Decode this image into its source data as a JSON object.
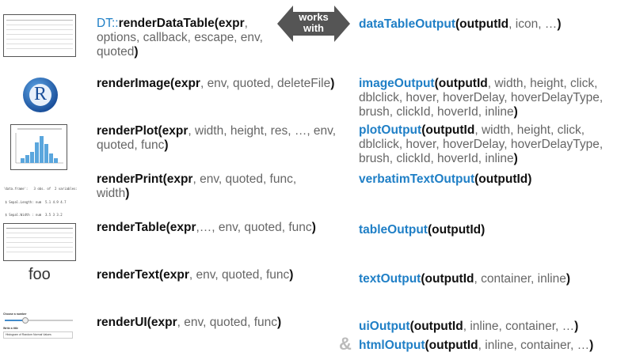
{
  "rows": [
    {
      "render_prefix": "DT::",
      "render_name": "renderDataTable",
      "render_args_open": "(expr",
      "render_args_rest": ", options, callback, escape, env, quoted",
      "render_close": ")",
      "output_name": "dataTableOutput",
      "output_open": "(outputId",
      "output_rest": ", icon, …",
      "output_close": ")"
    },
    {
      "render_name": "renderImage",
      "render_args_open": "(expr",
      "render_args_rest": ", env, quoted, deleteFile",
      "render_close": ")",
      "output_name": "imageOutput",
      "output_open": "(outputId",
      "output_rest": ", width, height, click, dblclick, hover, hoverDelay, hoverDelayType, brush, clickId, hoverId, inline",
      "output_close": ")"
    },
    {
      "render_name": "renderPlot",
      "render_args_open": "(expr",
      "render_args_rest": ", width, height, res, …, env, quoted, func",
      "render_close": ")",
      "output_name": "plotOutput",
      "output_open": "(outputId",
      "output_rest": ", width, height, click, dblclick, hover, hoverDelay, hoverDelayType, brush, clickId, hoverId, inline",
      "output_close": ")"
    },
    {
      "render_name": "renderPrint",
      "render_args_open": "(expr",
      "render_args_rest": ", env, quoted, func, width",
      "render_close": ")",
      "output_name": "verbatimTextOutput",
      "output_open": "(outputId",
      "output_rest": "",
      "output_close": ")"
    },
    {
      "render_name": "renderTable",
      "render_args_open": "(expr",
      "render_args_rest": ",…, env, quoted, func",
      "render_close": ")",
      "output_name": "tableOutput",
      "output_open": "(outputId",
      "output_rest": "",
      "output_close": ")"
    },
    {
      "render_name": "renderText",
      "render_args_open": "(expr",
      "render_args_rest": ", env, quoted, func",
      "render_close": ")",
      "output_name": "textOutput",
      "output_open": "(outputId",
      "output_rest": ", container, inline",
      "output_close": ")"
    },
    {
      "render_name": "renderUI",
      "render_args_open": "(expr",
      "render_args_rest": ", env, quoted, func",
      "render_close": ")",
      "output_name": "uiOutput",
      "output_open": "(outputId",
      "output_rest": ", inline, container, …",
      "output_close": ")"
    }
  ],
  "html_output": {
    "amp": "&",
    "output_name": "htmlOutput",
    "output_open": "(outputId",
    "output_rest": ", inline, container, …",
    "output_close": ")"
  },
  "arrow": {
    "line1": "works",
    "line2": "with",
    "color": "#555555"
  },
  "thumbs": {
    "r_logo_letter": "R",
    "verbatim_line1": "'data.frame':   3 obs. of  2 variables:",
    "verbatim_line2": " $ Sepal.Length: num  5.1 4.9 4.7",
    "verbatim_line3": " $ Sepal.Width : num  3.5 3 3.2",
    "foo_text": "foo",
    "ui_label1": "Choose a number",
    "ui_label2": "Write a title",
    "ui_input": "Histogram of Random Normal Values"
  },
  "colors": {
    "accent_blue": "#1f7fc6",
    "arg_gray": "#666666"
  }
}
